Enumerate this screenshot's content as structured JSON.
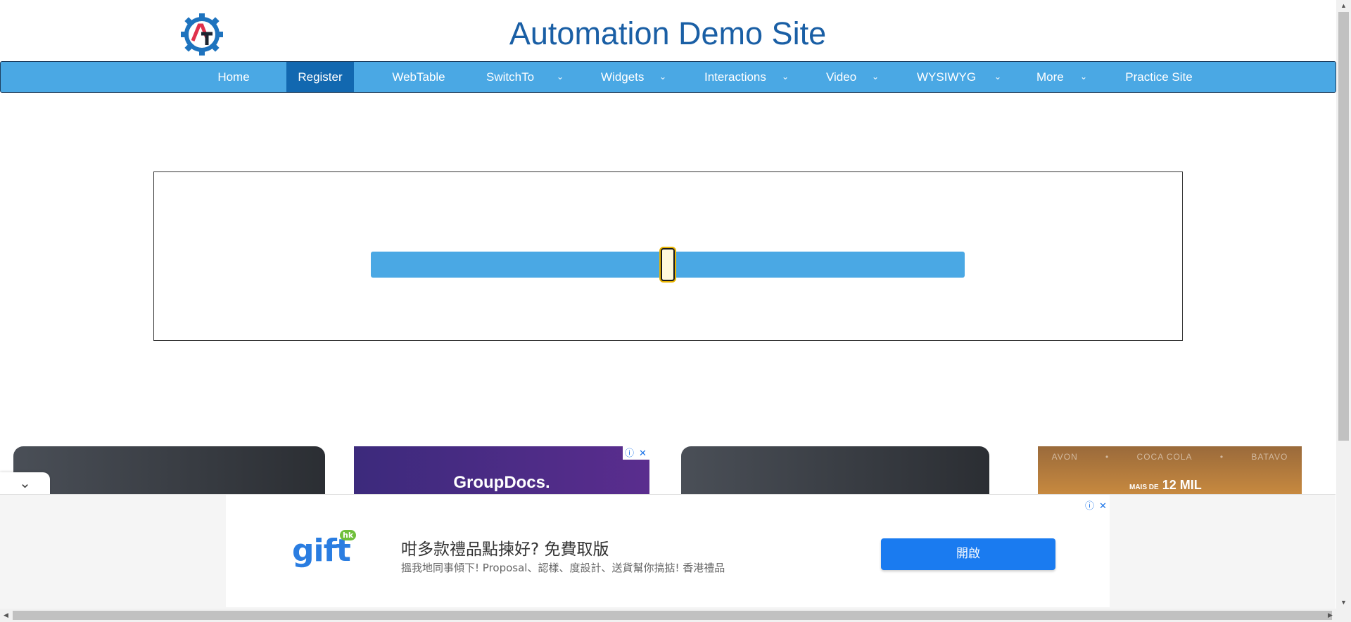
{
  "header": {
    "title": "Automation Demo Site",
    "logo_text": "AT"
  },
  "nav": {
    "items": [
      {
        "label": "Home",
        "dropdown": false
      },
      {
        "label": "Register",
        "dropdown": false,
        "active": true
      },
      {
        "label": "WebTable",
        "dropdown": false
      },
      {
        "label": "SwitchTo",
        "dropdown": true
      },
      {
        "label": "Widgets",
        "dropdown": true
      },
      {
        "label": "Interactions",
        "dropdown": true
      },
      {
        "label": "Video",
        "dropdown": true
      },
      {
        "label": "WYSIWYG",
        "dropdown": true
      },
      {
        "label": "More",
        "dropdown": true
      },
      {
        "label": "Practice Site",
        "dropdown": false
      }
    ],
    "chevron": "⌄"
  },
  "slider": {
    "value_fraction": 0.5
  },
  "ads": {
    "card2_text": "GroupDocs.",
    "card4_brands": [
      "AVON",
      "•",
      "COCA COLA",
      "•",
      "BATAVO"
    ],
    "card4_prefix": "MAIS DE",
    "card4_amount": "12 MIL",
    "info_glyph": "ⓘ",
    "close_glyph": "✕",
    "bottom": {
      "brand": "gift",
      "brand_badge": "hk",
      "headline": "咁多款禮品點揀好? 免費取版",
      "subtext": "搵我地同事傾下! Proposal、認樣、度設計、送貨幫你搞掂! 香港禮品",
      "button": "開啟"
    }
  },
  "collapse_glyph": "⌄",
  "colors": {
    "nav_bg": "#4aa8e4",
    "nav_active": "#1268b0",
    "title": "#1a5fa5",
    "ad_button": "#1a7bf0"
  }
}
